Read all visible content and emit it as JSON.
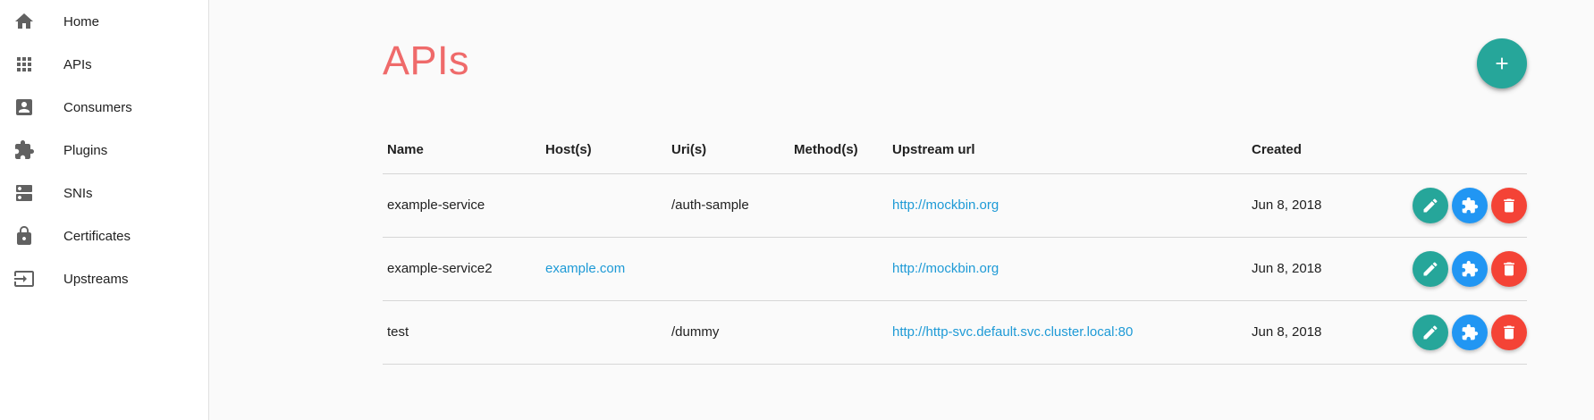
{
  "sidebar": {
    "items": [
      {
        "label": "Home",
        "icon": "home-icon"
      },
      {
        "label": "APIs",
        "icon": "apps-grid-icon"
      },
      {
        "label": "Consumers",
        "icon": "account-box-icon"
      },
      {
        "label": "Plugins",
        "icon": "puzzle-icon"
      },
      {
        "label": "SNIs",
        "icon": "server-icon"
      },
      {
        "label": "Certificates",
        "icon": "lock-icon"
      },
      {
        "label": "Upstreams",
        "icon": "input-icon"
      }
    ]
  },
  "page": {
    "title": "APIs",
    "add_button_icon": "plus-icon"
  },
  "table": {
    "headers": {
      "name": "Name",
      "hosts": "Host(s)",
      "uris": "Uri(s)",
      "methods": "Method(s)",
      "upstream": "Upstream url",
      "created": "Created"
    },
    "rows": [
      {
        "name": "example-service",
        "hosts": "",
        "uris": "/auth-sample",
        "methods": "",
        "upstream": "http://mockbin.org",
        "created": "Jun 8, 2018"
      },
      {
        "name": "example-service2",
        "hosts": "example.com",
        "uris": "",
        "methods": "",
        "upstream": "http://mockbin.org",
        "created": "Jun 8, 2018"
      },
      {
        "name": "test",
        "hosts": "",
        "uris": "/dummy",
        "methods": "",
        "upstream": "http://http-svc.default.svc.cluster.local:80",
        "created": "Jun 8, 2018"
      }
    ]
  },
  "colors": {
    "title": "#ef6a6a",
    "fab": "#26a69a",
    "edit": "#26a69a",
    "plugin": "#2196f3",
    "delete": "#f44336",
    "link": "#1e9ad6"
  }
}
